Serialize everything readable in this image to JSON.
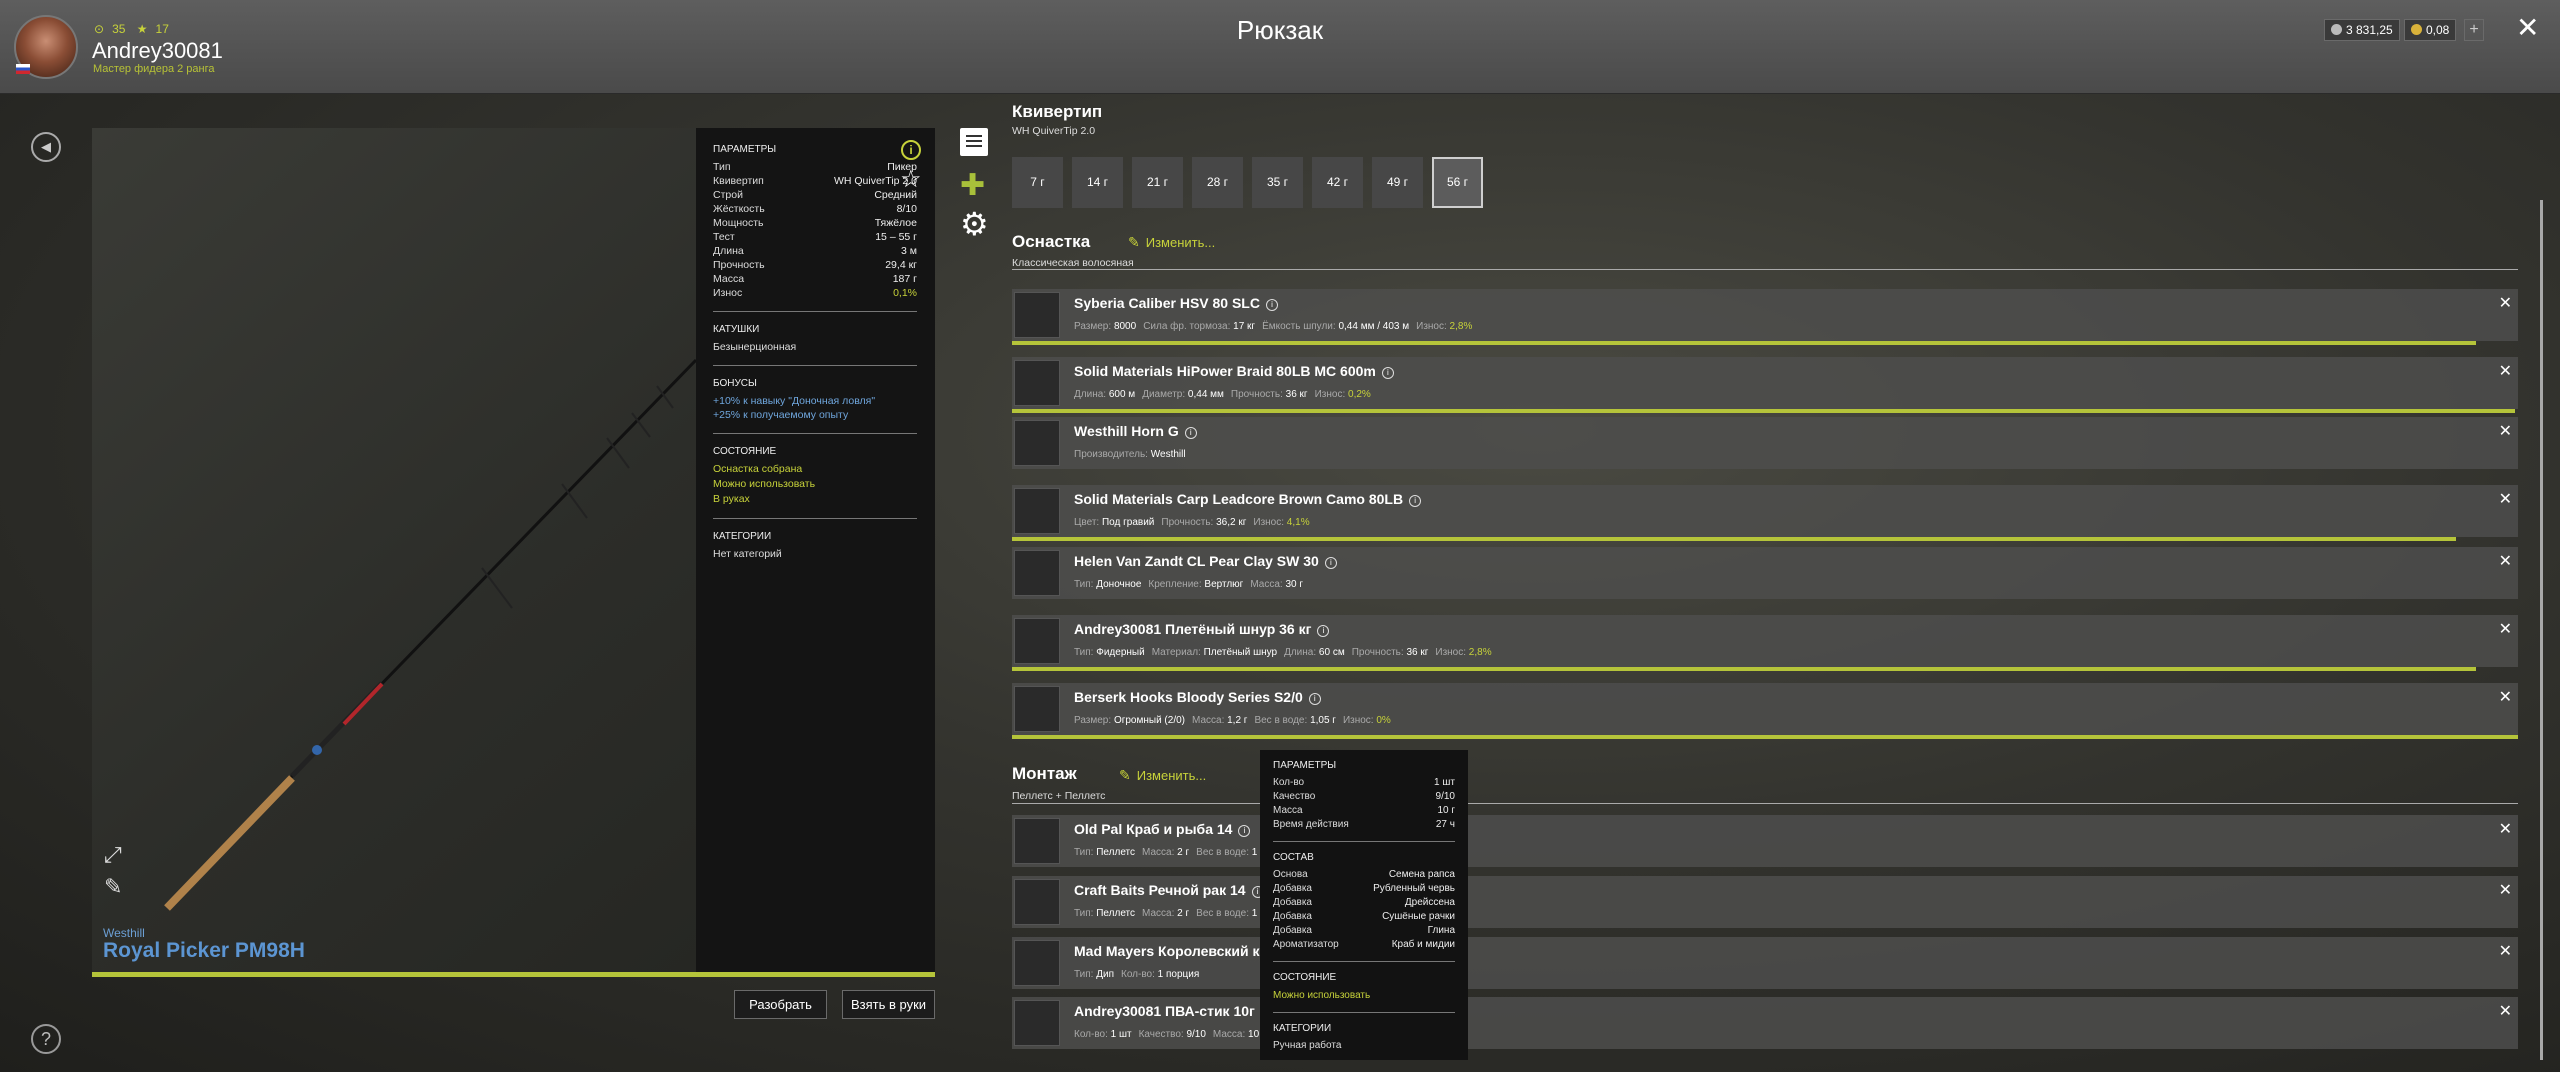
{
  "header": {
    "title": "Рюкзак",
    "username": "Andrey30081",
    "rank": "Мастер фидера 2 ранга",
    "stat_1": "35",
    "stat_2": "17",
    "silver": "3 831,25",
    "gold": "0,08",
    "plus_label": "+"
  },
  "rod": {
    "brand": "Westhill",
    "name": "Royal Picker PM98H",
    "sections": {
      "params_title": "Параметры",
      "reels_title": "Катушки",
      "bonuses_title": "Бонусы",
      "state_title": "Состояние",
      "categories_title": "Категории"
    },
    "params": [
      {
        "label": "Тип",
        "value": "Пикер"
      },
      {
        "label": "Квивертип",
        "value": "WH QuiverTip 2.0"
      },
      {
        "label": "Строй",
        "value": "Средний"
      },
      {
        "label": "Жёсткость",
        "value": "8/10"
      },
      {
        "label": "Мощность",
        "value": "Тяжёлое"
      },
      {
        "label": "Тест",
        "value": "15 – 55 г"
      },
      {
        "label": "Длина",
        "value": "3 м"
      },
      {
        "label": "Прочность",
        "value": "29,4 кг"
      },
      {
        "label": "Масса",
        "value": "187 г"
      },
      {
        "label": "Износ",
        "value": "0,1%"
      }
    ],
    "reels": "Безынерционная",
    "bonus_1": "+10% к навыку \"Доночная ловля\"",
    "bonus_2": "+25% к получаемому опыту",
    "state_1": "Оснастка собрана",
    "state_2": "Можно использовать",
    "state_3": "В руках",
    "categories": "Нет категорий"
  },
  "buttons": {
    "disassemble": "Разобрать",
    "take": "Взять в руки"
  },
  "quivertip": {
    "title": "Квивертип",
    "subtitle": "WH QuiverTip 2.0",
    "weights": [
      "7 г",
      "14 г",
      "21 г",
      "28 г",
      "35 г",
      "42 г",
      "49 г",
      "56 г"
    ],
    "selected": "56 г"
  },
  "rig": {
    "title": "Оснастка",
    "edit": "Изменить...",
    "subtitle": "Классическая волосяная",
    "items": [
      {
        "name": "Syberia Caliber HSV 80 SLC",
        "props": [
          [
            "Размер:",
            "8000"
          ],
          [
            "Сила фр. тормоза:",
            "17 кг"
          ],
          [
            "Ёмкость шпули:",
            "0,44 мм / 403 м"
          ]
        ],
        "wear_label": "Износ:",
        "wear": "2,8%",
        "bar": 0.972
      },
      {
        "name": "Solid Materials HiPower Braid 80LB MC 600m",
        "props": [
          [
            "Длина:",
            "600 м"
          ],
          [
            "Диаметр:",
            "0,44 мм"
          ],
          [
            "Прочность:",
            "36 кг"
          ]
        ],
        "wear_label": "Износ:",
        "wear": "0,2%",
        "bar": 0.998
      },
      {
        "name": "Westhill Horn G",
        "props": [
          [
            "Производитель:",
            "Westhill"
          ]
        ],
        "wear_label": "",
        "wear": "",
        "bar": 0
      },
      {
        "name": "Solid Materials Carp Leadcore Brown Camo 80LB",
        "props": [
          [
            "Цвет:",
            "Под гравий"
          ],
          [
            "Прочность:",
            "36,2 кг"
          ]
        ],
        "wear_label": "Износ:",
        "wear": "4,1%",
        "bar": 0.959
      },
      {
        "name": "Helen Van Zandt CL Pear Clay SW 30",
        "props": [
          [
            "Тип:",
            "Доночное"
          ],
          [
            "Крепление:",
            "Вертлюг"
          ],
          [
            "Масса:",
            "30 г"
          ]
        ],
        "wear_label": "",
        "wear": "",
        "bar": 0
      },
      {
        "name": "Andrey30081 Плетёный шнур 36 кг",
        "props": [
          [
            "Тип:",
            "Фидерный"
          ],
          [
            "Материал:",
            "Плетёный шнур"
          ],
          [
            "Длина:",
            "60 см"
          ],
          [
            "Прочность:",
            "36 кг"
          ]
        ],
        "wear_label": "Износ:",
        "wear": "2,8%",
        "bar": 0.972
      },
      {
        "name": "Berserk Hooks Bloody Series S2/0",
        "props": [
          [
            "Размер:",
            "Огромный (2/0)"
          ],
          [
            "Масса:",
            "1,2 г"
          ],
          [
            "Вес в воде:",
            "1,05 г"
          ]
        ],
        "wear_label": "Износ:",
        "wear": "0%",
        "bar": 1.0
      }
    ]
  },
  "mount": {
    "title": "Монтаж",
    "edit": "Изменить...",
    "subtitle": "Пеллетс + Пеллетс",
    "items": [
      {
        "name": "Old Pal Краб и рыба 14",
        "props": [
          [
            "Тип:",
            "Пеллетс"
          ],
          [
            "Масса:",
            "2 г"
          ],
          [
            "Вес в воде:",
            "1 г"
          ]
        ]
      },
      {
        "name": "Craft Baits Речной рак 14",
        "props": [
          [
            "Тип:",
            "Пеллетс"
          ],
          [
            "Масса:",
            "2 г"
          ],
          [
            "Вес в воде:",
            "1 г"
          ]
        ]
      },
      {
        "name": "Mad Mayers Королевский кр",
        "props": [
          [
            "Тип:",
            "Дип"
          ],
          [
            "Кол-во:",
            "1 порция"
          ]
        ]
      },
      {
        "name": "Andrey30081 ПВА-стик 10г",
        "props": [
          [
            "Кол-во:",
            "1 шт"
          ],
          [
            "Качество:",
            "9/10"
          ],
          [
            "Масса:",
            "10 г"
          ]
        ]
      }
    ]
  },
  "tooltip": {
    "params_title": "Параметры",
    "params": [
      {
        "label": "Кол-во",
        "value": "1 шт"
      },
      {
        "label": "Качество",
        "value": "9/10"
      },
      {
        "label": "Масса",
        "value": "10 г"
      },
      {
        "label": "Время действия",
        "value": "27 ч"
      }
    ],
    "composition_title": "Состав",
    "composition": [
      {
        "label": "Основа",
        "value": "Семена рапса"
      },
      {
        "label": "Добавка",
        "value": "Рубленный червь"
      },
      {
        "label": "Добавка",
        "value": "Дрейссена"
      },
      {
        "label": "Добавка",
        "value": "Сушёные рачки"
      },
      {
        "label": "Добавка",
        "value": "Глина"
      },
      {
        "label": "Ароматизатор",
        "value": "Краб и мидии"
      }
    ],
    "state_title": "Состояние",
    "state": "Можно использовать",
    "categories_title": "Категории",
    "categories": "Ручная работа"
  }
}
